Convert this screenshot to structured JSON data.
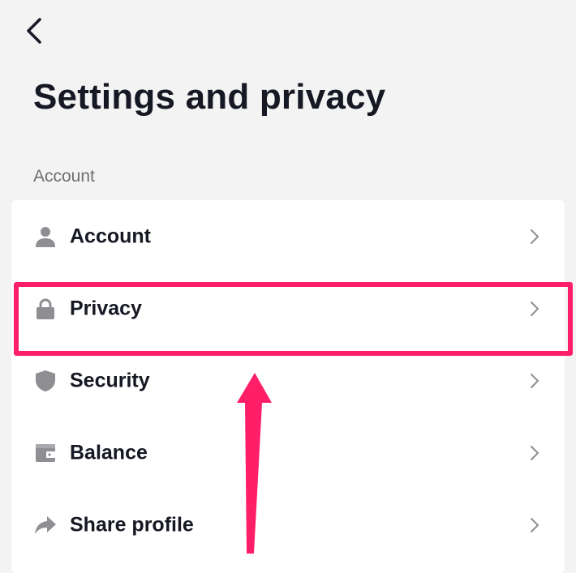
{
  "header": {
    "title": "Settings and privacy"
  },
  "section": {
    "label": "Account"
  },
  "settings": {
    "items": [
      {
        "label": "Account",
        "icon": "person-icon"
      },
      {
        "label": "Privacy",
        "icon": "lock-icon",
        "highlighted": true
      },
      {
        "label": "Security",
        "icon": "shield-icon"
      },
      {
        "label": "Balance",
        "icon": "wallet-icon"
      },
      {
        "label": "Share profile",
        "icon": "share-icon"
      }
    ]
  },
  "colors": {
    "background": "#f3f3f3",
    "card": "#ffffff",
    "text": "#161823",
    "secondary_text": "#6d6d73",
    "icon_gray": "#8e8e93",
    "annotation": "#ff1f68"
  }
}
